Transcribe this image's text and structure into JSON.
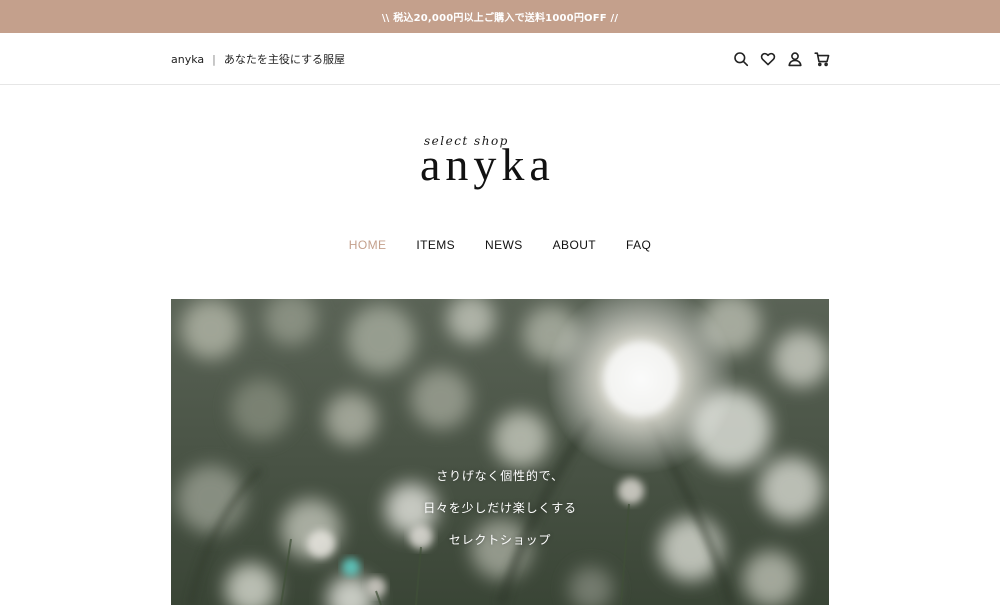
{
  "announcement": "\\\\ 税込20,000円以上ご購入で送料1000円OFF //",
  "header": {
    "brand": "anyka",
    "separator": "|",
    "tagline": "あなたを主役にする服屋",
    "icons": [
      "search-icon",
      "heart-icon",
      "user-icon",
      "cart-icon"
    ]
  },
  "logo": {
    "sub": "select shop",
    "main": "anyka"
  },
  "nav": {
    "items": [
      {
        "label": "HOME",
        "active": true
      },
      {
        "label": "ITEMS",
        "active": false
      },
      {
        "label": "NEWS",
        "active": false
      },
      {
        "label": "ABOUT",
        "active": false
      },
      {
        "label": "FAQ",
        "active": false
      }
    ]
  },
  "hero": {
    "lines": [
      "さりげなく個性的で、",
      "日々を少しだけ楽しくする",
      "セレクトショップ"
    ]
  },
  "colors": {
    "accent": "#c4a08c",
    "announcement_bg": "#c4a08c",
    "text": "#222222"
  }
}
